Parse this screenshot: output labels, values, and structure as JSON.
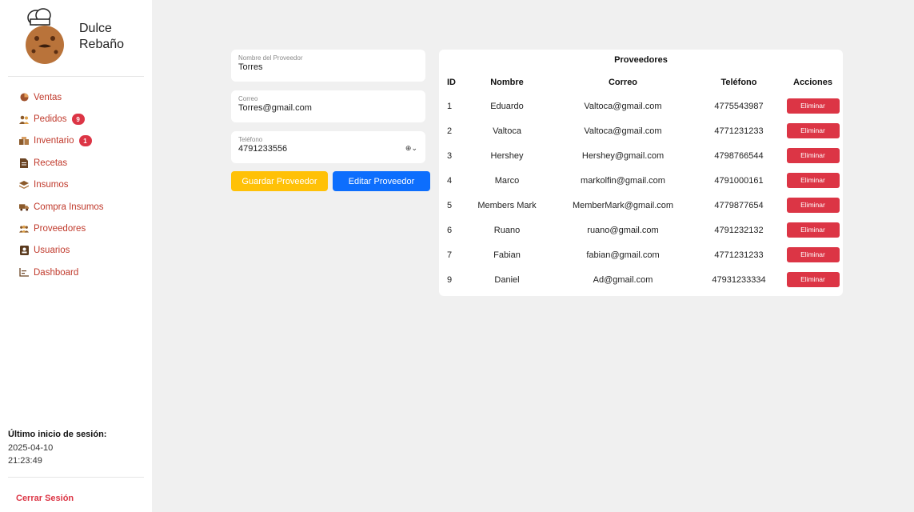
{
  "brand": {
    "line1": "Dulce",
    "line2": "Rebaño"
  },
  "nav": [
    {
      "label": "Ventas",
      "icon": "pie-chart-icon"
    },
    {
      "label": "Pedidos",
      "icon": "users-icon",
      "badge": "9"
    },
    {
      "label": "Inventario",
      "icon": "boxes-icon",
      "badge": "1"
    },
    {
      "label": "Recetas",
      "icon": "document-icon"
    },
    {
      "label": "Insumos",
      "icon": "layers-icon"
    },
    {
      "label": "Compra Insumos",
      "icon": "truck-icon"
    },
    {
      "label": "Proveedores",
      "icon": "people-group-icon"
    },
    {
      "label": "Usuarios",
      "icon": "id-card-icon"
    },
    {
      "label": "Dashboard",
      "icon": "chart-icon"
    }
  ],
  "session": {
    "title": "Último inicio de sesión:",
    "date": "2025-04-10",
    "time": "21:23:49"
  },
  "logout_label": "Cerrar Sesión",
  "form": {
    "name_label": "Nombre del Proveedor",
    "name_value": "Torres",
    "email_label": "Correo",
    "email_value": "Torres@gmail.com",
    "phone_label": "Teléfono",
    "phone_value": "4791233556",
    "phone_picker": "⊕⌄",
    "save_label": "Guardar Proveedor",
    "edit_label": "Editar Proveedor"
  },
  "table": {
    "title": "Proveedores",
    "headers": {
      "id": "ID",
      "nombre": "Nombre",
      "correo": "Correo",
      "telefono": "Teléfono",
      "acciones": "Acciones"
    },
    "delete_label": "Eliminar",
    "rows": [
      {
        "id": "1",
        "nombre": "Eduardo",
        "correo": "Valtoca@gmail.com",
        "telefono": "4775543987"
      },
      {
        "id": "2",
        "nombre": "Valtoca",
        "correo": "Valtoca@gmail.com",
        "telefono": "4771231233"
      },
      {
        "id": "3",
        "nombre": "Hershey",
        "correo": "Hershey@gmail.com",
        "telefono": "4798766544"
      },
      {
        "id": "4",
        "nombre": "Marco",
        "correo": "markolfin@gmail.com",
        "telefono": "4791000161"
      },
      {
        "id": "5",
        "nombre": "Members Mark",
        "correo": "MemberMark@gmail.com",
        "telefono": "4779877654"
      },
      {
        "id": "6",
        "nombre": "Ruano",
        "correo": "ruano@gmail.com",
        "telefono": "4791232132"
      },
      {
        "id": "7",
        "nombre": "Fabian",
        "correo": "fabian@gmail.com",
        "telefono": "4771231233"
      },
      {
        "id": "9",
        "nombre": "Daniel",
        "correo": "Ad@gmail.com",
        "telefono": "47931233334"
      }
    ]
  },
  "colors": {
    "accent_red": "#dc3545",
    "warning": "#ffc107",
    "primary": "#0d6efd",
    "nav_text": "#c0392b",
    "background": "#f0f0f0"
  }
}
